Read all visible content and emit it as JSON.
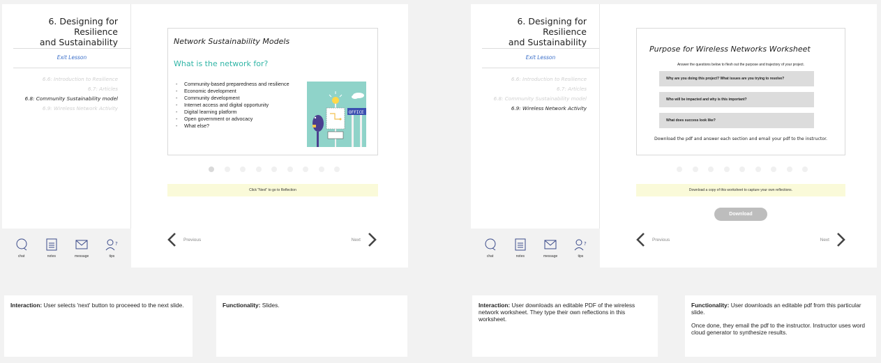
{
  "screen1": {
    "course_title_line1": "6. Designing for Resilience",
    "course_title_line2": "and Sustainability",
    "exit_label": "Exit Lesson",
    "lessons": [
      {
        "label": "6.6: Introduction to Resilience"
      },
      {
        "label": "6.7: Articles"
      },
      {
        "label": "6.8: Community Sustainability model"
      },
      {
        "label": "6.9: Wireless Network Activity"
      }
    ],
    "slide": {
      "title": "Network Sustainability Models",
      "heading": "What is the network for?",
      "bullets": [
        "Community-based preparedness and resilience",
        "Economic development",
        "Community development",
        "Internet access and digital opportunity",
        "Digital learning platform",
        "Open government or advocacy",
        "What else?"
      ],
      "illustration_sign": "OFFICE"
    },
    "pagination": {
      "count": 9,
      "active": 1
    },
    "note": "Click \"Next\" to go to Reflection",
    "prev_label": "Previous",
    "next_label": "Next"
  },
  "screen2": {
    "course_title_line1": "6. Designing for Resilience",
    "course_title_line2": "and Sustainability",
    "exit_label": "Exit Lesson",
    "lessons": [
      {
        "label": "6.6: Introduction to Resilience"
      },
      {
        "label": "6.7: Articles"
      },
      {
        "label": "6.8: Community Sustainability model"
      },
      {
        "label": "6.9: Wireless Network Activity"
      }
    ],
    "slide": {
      "title": "Purpose for Wireless Networks Worksheet",
      "intro": "Answer the questions below to flesh out the purpose and trajectory of your project.",
      "questions": [
        "Why are you doing this project?  What issues are you trying to resolve?",
        "Who will be impacted and why is this important?",
        "What does success look like?"
      ],
      "footer": "Download the pdf and answer each section and email your pdf to the instructor."
    },
    "pagination": {
      "count": 9,
      "active": 0
    },
    "note": "Download a copy of this worksheet to capture your own reflections.",
    "download_label": "Download",
    "prev_label": "Previous",
    "next_label": "Next"
  },
  "toolbar": {
    "chat": "chat",
    "notes": "notes",
    "message": "message",
    "tips": "tips"
  },
  "descriptions": {
    "d1": {
      "bold": "Interaction:",
      "text": " User selects 'next' button to proceeed to the next slide."
    },
    "d2": {
      "bold": "Functionality:",
      "text": " Slides."
    },
    "d3": {
      "bold": "Interaction:",
      "text": " User downloads an editable PDF of the wireless network worksheet. They type their own reflections in this worksheet."
    },
    "d4": {
      "bold": "Functionality:",
      "text": " User downloads an editable pdf from this particular slide.",
      "text2": "Once done, they email the pdf to the instructor. Instructor uses word cloud generator to synthesize results."
    }
  },
  "colors": {
    "accent_teal": "#30b5a6",
    "link_blue": "#3b6fc9",
    "note_bg": "#fafad9",
    "illustration_bg": "#8fd3c9"
  }
}
